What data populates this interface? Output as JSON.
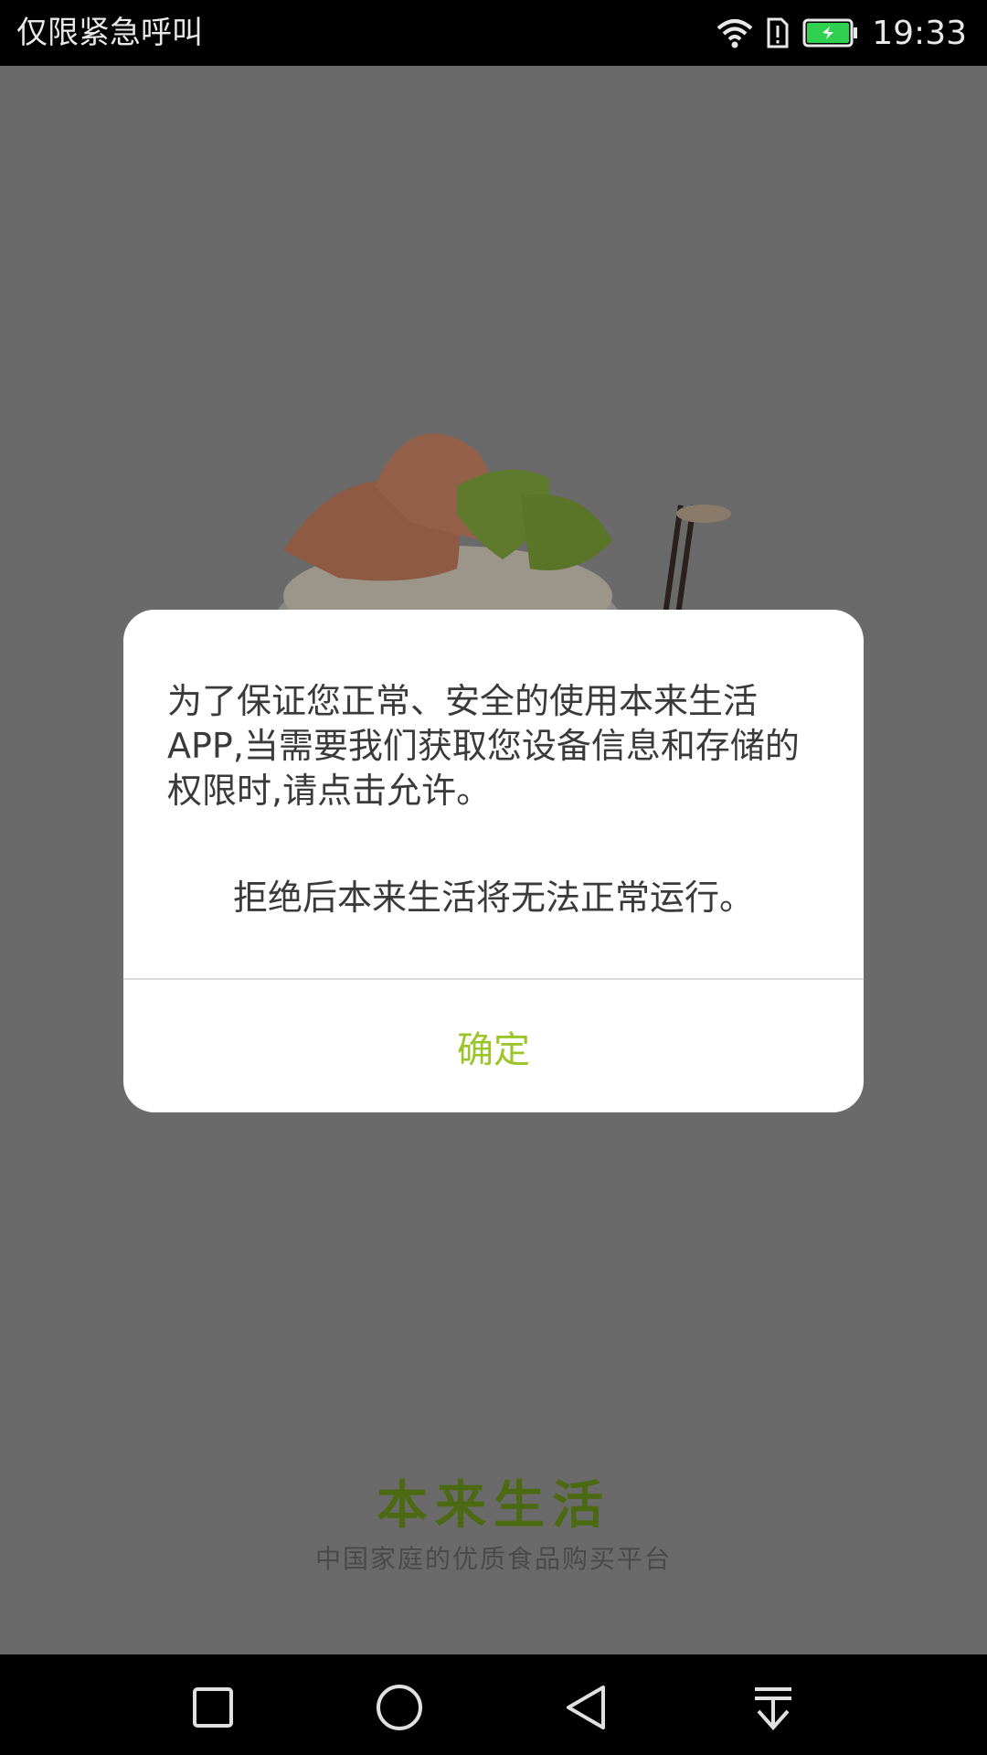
{
  "status_bar": {
    "carrier_text": "仅限紧急呼叫",
    "time": "19:33",
    "icons": [
      "wifi-icon",
      "sim-alert-icon",
      "battery-charging-icon"
    ]
  },
  "splash": {
    "brand_name": "本来生活",
    "tagline": "中国家庭的优质食品购买平台"
  },
  "dialog": {
    "message": "为了保证您正常、安全的使用本来生活APP,当需要我们获取您设备信息和存储的权限时,请点击允许。",
    "warning": "拒绝后本来生活将无法正常运行。",
    "confirm_label": "确定"
  },
  "nav_bar": {
    "buttons": [
      "recent-apps",
      "home",
      "back",
      "notification-pull-down"
    ]
  },
  "colors": {
    "accent": "#9bc52a",
    "brand_green": "#4c6a12",
    "scrim": "#6a6a6a"
  }
}
